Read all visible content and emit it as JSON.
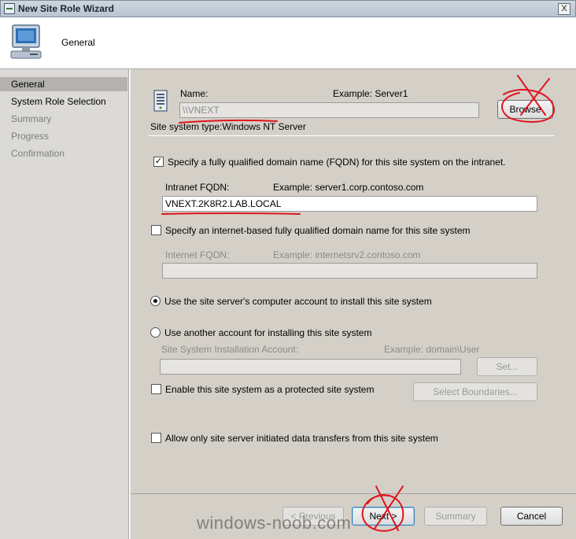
{
  "window": {
    "title": "New Site Role Wizard",
    "close_glyph": "X"
  },
  "header": {
    "title": "General",
    "icon": "computer-icon"
  },
  "sidebar": {
    "items": [
      {
        "label": "General",
        "state": "active"
      },
      {
        "label": "System Role Selection",
        "state": "enabled"
      },
      {
        "label": "Summary",
        "state": "disabled"
      },
      {
        "label": "Progress",
        "state": "disabled"
      },
      {
        "label": "Confirmation",
        "state": "disabled"
      }
    ]
  },
  "form": {
    "name_label": "Name:",
    "name_example": "Example: Server1",
    "name_value": "\\\\VNEXT",
    "browse_label": "Browse",
    "site_system_type": "Site system type:Windows NT Server",
    "fqdn_check_label": "Specify a fully qualified domain name (FQDN) for this site system on the intranet.",
    "fqdn_checked": true,
    "intranet_fqdn_label": "Intranet FQDN:",
    "intranet_fqdn_example": "Example: server1.corp.contoso.com",
    "intranet_fqdn_value": "VNEXT.2K8R2.LAB.LOCAL",
    "internet_check_label": "Specify an internet-based fully qualified domain name for this site system",
    "internet_checked": false,
    "internet_fqdn_label": "Internet FQDN:",
    "internet_fqdn_example": "Example: internetsrv2.contoso.com",
    "internet_fqdn_value": "",
    "radio_server_account": "Use the site server's computer account to install this site system",
    "radio_another_account": "Use another account for installing this site system",
    "install_account_label": "Site System Installation Account:",
    "install_account_example": "Example: domain\\User",
    "install_account_value": "",
    "set_label": "Set...",
    "protected_label": "Enable this site system as a protected site system",
    "protected_checked": false,
    "select_boundaries_label": "Select Boundaries...",
    "allow_only_label": "Allow only site server initiated data transfers from this site system",
    "allow_only_checked": false
  },
  "footer": {
    "previous_label": "< Previous",
    "next_label": "Next >",
    "summary_label": "Summary",
    "cancel_label": "Cancel"
  },
  "watermark": "windows-noob.com",
  "colors": {
    "annotation": "#e0141e",
    "sidebar_bg": "#dcdad6",
    "content_bg": "#d4d0c8"
  }
}
